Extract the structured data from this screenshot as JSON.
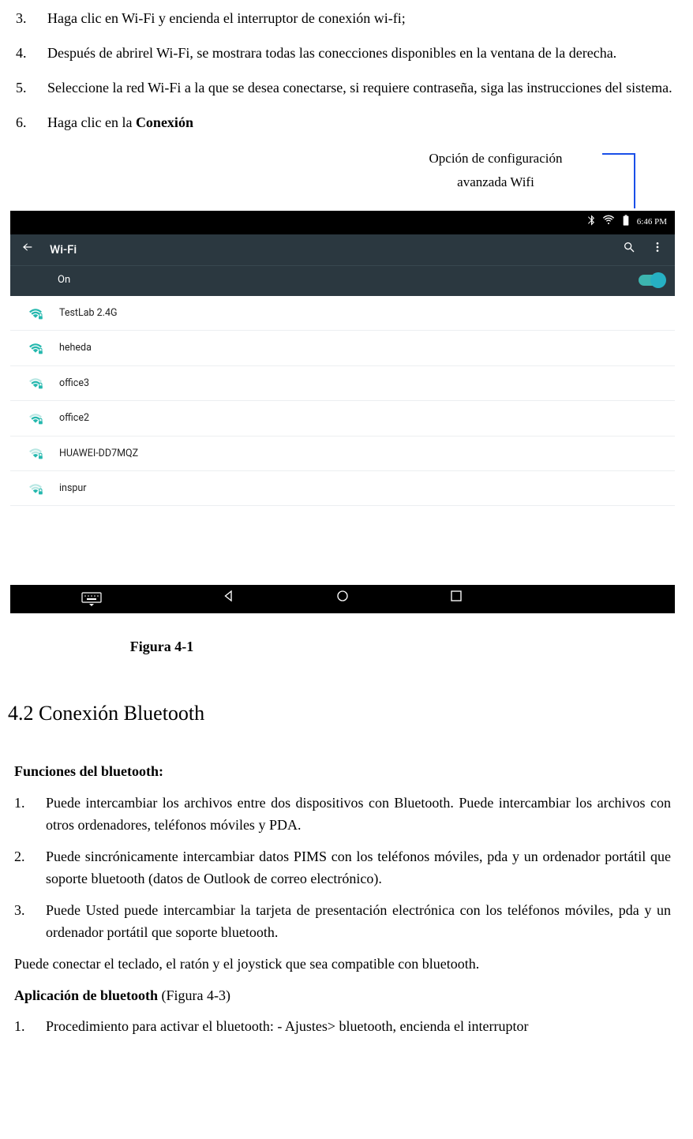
{
  "steps_top": [
    {
      "n": "3.",
      "text": "Haga clic en Wi-Fi y encienda el interruptor de conexión wi-fi;"
    },
    {
      "n": "4.",
      "text": "Después de abrirel Wi-Fi, se mostrara todas las conecciones disponibles en la ventana de la derecha."
    },
    {
      "n": "5.",
      "text": "Seleccione la red Wi-Fi a la que se desea conectarse, si requiere contraseña, siga las instrucciones del sistema."
    },
    {
      "n": "6.",
      "text_pre": "Haga clic en la ",
      "text_bold": "Conexión"
    }
  ],
  "callout": "Opción de configuración avanzada Wifi",
  "screenshot": {
    "status_time": "6:46 PM",
    "title": "Wi-Fi",
    "on_label": "On",
    "networks": [
      {
        "name": "TestLab 2.4G",
        "strength": "full",
        "locked": true
      },
      {
        "name": "heheda",
        "strength": "full",
        "locked": true
      },
      {
        "name": "office3",
        "strength": "med",
        "locked": true
      },
      {
        "name": "office2",
        "strength": "med",
        "locked": true
      },
      {
        "name": "HUAWEI-DD7MQZ",
        "strength": "low",
        "locked": true
      },
      {
        "name": "inspur",
        "strength": "low",
        "locked": true
      }
    ]
  },
  "figure_caption": "Figura   4-1",
  "section_heading": "4.2 Conexión Bluetooth",
  "bt_funcs_head": "Funciones del bluetooth:",
  "bt_funcs": [
    {
      "n": "1.",
      "text": "Puede intercambiar los archivos entre dos dispositivos con Bluetooth. Puede intercambiar los archivos con otros ordenadores, teléfonos móviles y PDA."
    },
    {
      "n": "2.",
      "text": "Puede sincrónicamente intercambiar datos PIMS con los teléfonos móviles, pda y un ordenador portátil que soporte bluetooth (datos de Outlook de correo electrónico)."
    },
    {
      "n": "3.",
      "text": "Puede Usted puede intercambiar la tarjeta de presentación electrónica con los teléfonos móviles, pda y un ordenador portátil que soporte bluetooth."
    }
  ],
  "bt_para": "Puede conectar el teclado, el ratón y el joystick que sea compatible con bluetooth.",
  "bt_app_head_bold": "Aplicación de bluetooth",
  "bt_app_head_rest": " (Figura 4-3)",
  "bt_app_steps": [
    {
      "n": "1.",
      "text": "Procedimiento para activar el bluetooth: - Ajustes> bluetooth,   encienda el interruptor"
    }
  ]
}
